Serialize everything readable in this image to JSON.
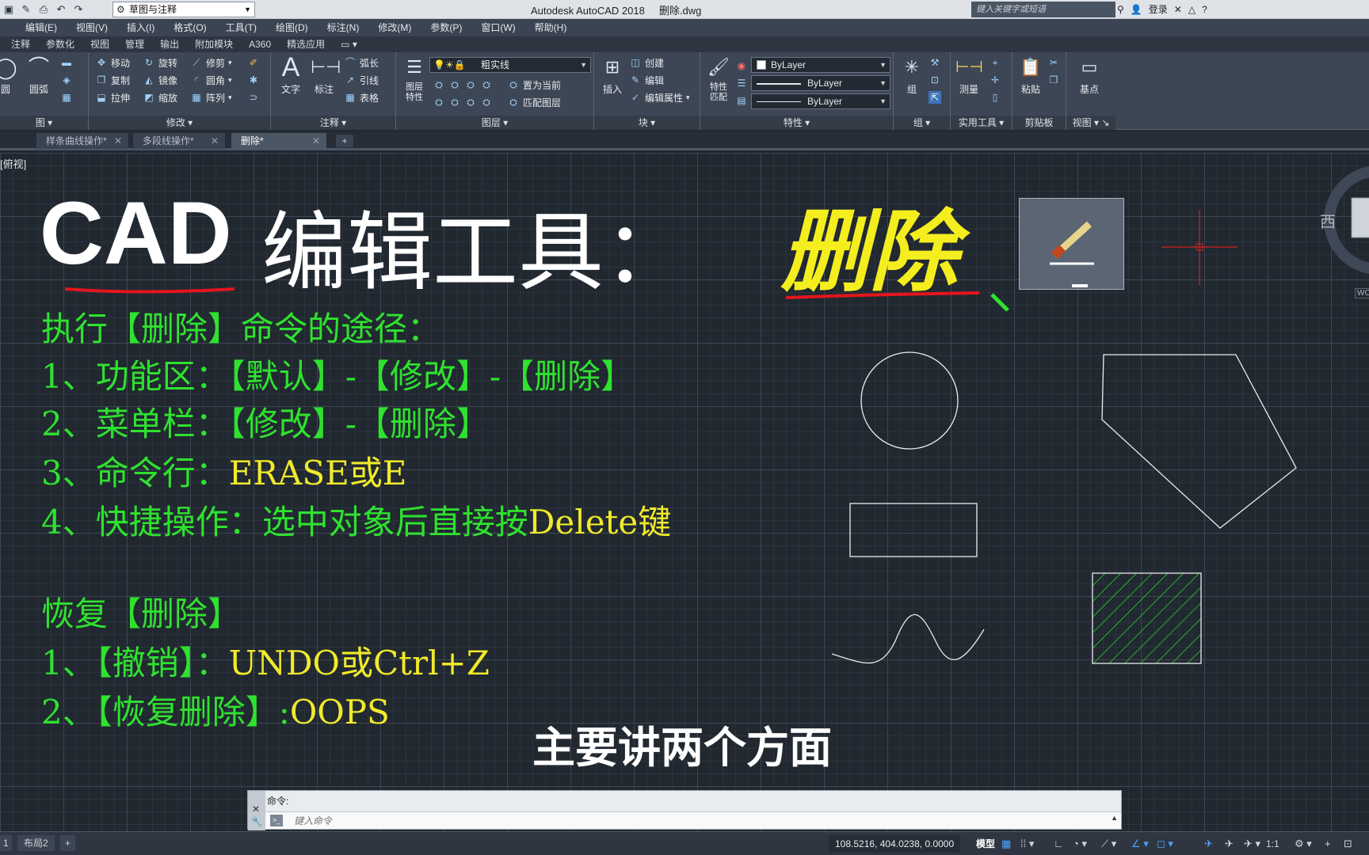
{
  "title_bar": {
    "app_title": "Autodesk AutoCAD 2018",
    "file_name": "删除.dwg",
    "workspace": "草图与注释",
    "search_placeholder": "键入关键字或短语",
    "login": "登录"
  },
  "menu": [
    "编辑(E)",
    "视图(V)",
    "插入(I)",
    "格式(O)",
    "工具(T)",
    "绘图(D)",
    "标注(N)",
    "修改(M)",
    "参数(P)",
    "窗口(W)",
    "帮助(H)"
  ],
  "ribbon_tabs": [
    "注释",
    "参数化",
    "视图",
    "管理",
    "输出",
    "附加模块",
    "A360",
    "精选应用"
  ],
  "ribbon": {
    "draw": {
      "circle": "圆",
      "arc": "圆弧",
      "title": "图"
    },
    "modify": {
      "move": "移动",
      "rotate": "旋转",
      "trim": "修剪",
      "copy": "复制",
      "mirror": "镜像",
      "fillet": "圆角",
      "stretch": "拉伸",
      "scale": "缩放",
      "array": "阵列",
      "title": "修改"
    },
    "annotation": {
      "text": "文字",
      "dim": "标注",
      "arc_len": "弧长",
      "leader": "引线",
      "table": "表格",
      "title": "注释"
    },
    "layers": {
      "props": "图层\n特性",
      "current_layer": "粗实线",
      "make_current": "置为当前",
      "match": "匹配图层",
      "title": "图层"
    },
    "block": {
      "insert": "插入",
      "create": "创建",
      "edit": "编辑",
      "edit_attr": "编辑属性",
      "title": "块"
    },
    "properties": {
      "match": "特性\n匹配",
      "color": "ByLayer",
      "linetype": "ByLayer",
      "lineweight": "ByLayer",
      "title": "特性"
    },
    "groups": {
      "group": "组",
      "title": "组"
    },
    "utilities": {
      "measure": "测量",
      "title": "实用工具"
    },
    "clipboard": {
      "paste": "粘贴",
      "title": "剪贴板"
    },
    "view": {
      "base": "基点",
      "title": "视图"
    }
  },
  "doc_tabs": [
    {
      "label": "样条曲线操作*"
    },
    {
      "label": "多段线操作*"
    },
    {
      "label": "删除*",
      "active": true
    }
  ],
  "canvas": {
    "view_label": "[俯视]",
    "title_a": "CAD",
    "title_b": "编辑工具：",
    "title_c": "删除",
    "lines": {
      "l1": "执行【删除】命令的途径：",
      "l2": "1、功能区：【默认】-【修改】-【删除】",
      "l3a": "2、菜单栏：【修改】-【删除】",
      "l4a": "3、命令行：",
      "l4b": "ERASE或E",
      "l5a": "4、快捷操作：选中对象后直接按",
      "l5b": "Delete键",
      "r1": "恢复【删除】",
      "r2a": "1、【撤销】：",
      "r2b": "UNDO或Ctrl+Z",
      "r3a": "2、【恢复删除】:",
      "r3b": "OOPS"
    },
    "subtitle": "主要讲两个方面",
    "viewcube_west": "西",
    "wcs": "WCS"
  },
  "command_line": {
    "history": "命令:",
    "placeholder": "键入命令"
  },
  "status_bar": {
    "layout_tab": "布局2",
    "coords": "108.5216, 404.0238, 0.0000",
    "model": "模型",
    "scale": "1:1"
  },
  "colors": {
    "green_text": "#2fe22f",
    "yellow_text": "#f0ea2a",
    "canvas_bg": "#212830"
  }
}
